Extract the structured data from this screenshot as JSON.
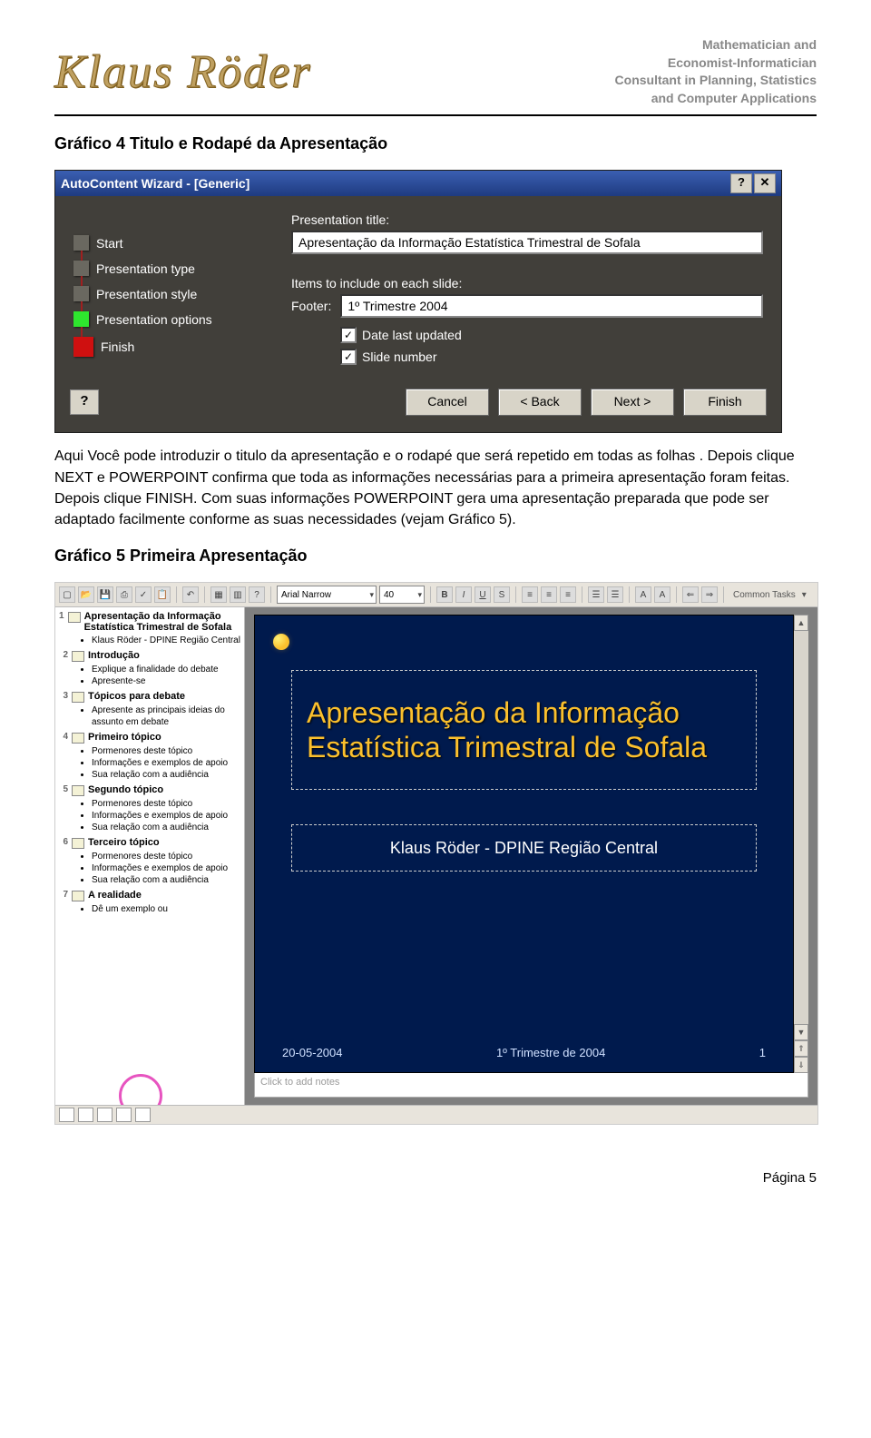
{
  "header": {
    "name": "Klaus Röder",
    "tagline": [
      "Mathematician and",
      "Economist-Informatician",
      "Consultant in Planning, Statistics",
      "and Computer Applications"
    ]
  },
  "caption1": "Gráfico 4 Titulo e Rodapé da Apresentação",
  "wizard": {
    "title": "AutoContent Wizard - [Generic]",
    "help": "?",
    "close": "✕",
    "steps": [
      {
        "label": "Start",
        "color": "#6a6860"
      },
      {
        "label": "Presentation type",
        "color": "#6a6860"
      },
      {
        "label": "Presentation style",
        "color": "#6a6860"
      },
      {
        "label": "Presentation options",
        "color": "#2ee62e"
      },
      {
        "label": "Finish",
        "color": "#cf1010"
      }
    ],
    "title_label": "Presentation title:",
    "title_value": "Apresentação da Informação Estatística Trimestral de Sofala",
    "items_label": "Items to include on each slide:",
    "footer_label": "Footer:",
    "footer_value": "1º Trimestre 2004",
    "cb_date": "Date last updated",
    "cb_slide": "Slide number",
    "help_btn": "?",
    "cancel": "Cancel",
    "back": "< Back",
    "next": "Next >",
    "finish": "Finish"
  },
  "para1": "Aqui Você pode introduzir o titulo da apresentação e o rodapé que será repetido em todas as folhas . Depois clique NEXT e  POWERPOINT  confirma que toda as informações necessárias para a primeira apresentação foram feitas. Depois clique FINISH. Com suas informações  POWERPOINT  gera uma apresentação preparada que pode ser adaptado facilmente conforme as suas necessidades (vejam Gráfico 5).",
  "caption2": "Gráfico 5 Primeira Apresentação",
  "ppt": {
    "font": "Arial Narrow",
    "size": "40",
    "common": "Common Tasks",
    "outline": [
      {
        "n": "1",
        "t": "Apresentação da Informação Estatística Trimestral de Sofala",
        "b": [
          "Klaus Röder - DPINE Região Central"
        ]
      },
      {
        "n": "2",
        "t": "Introdução",
        "b": [
          "Explique a finalidade do debate",
          "Apresente-se"
        ]
      },
      {
        "n": "3",
        "t": "Tópicos para debate",
        "b": [
          "Apresente as principais ideias do assunto em debate"
        ]
      },
      {
        "n": "4",
        "t": "Primeiro tópico",
        "b": [
          "Pormenores deste tópico",
          "Informações e exemplos de apoio",
          "Sua relação com a audiência"
        ]
      },
      {
        "n": "5",
        "t": "Segundo tópico",
        "b": [
          "Pormenores deste tópico",
          "Informações e exemplos de apoio",
          "Sua relação com a audiência"
        ]
      },
      {
        "n": "6",
        "t": "Terceiro tópico",
        "b": [
          "Pormenores deste tópico",
          "Informações e exemplos de apoio",
          "Sua relação com a audiência"
        ]
      },
      {
        "n": "7",
        "t": "A realidade",
        "b": [
          "Dê um exemplo ou"
        ]
      }
    ],
    "slide": {
      "title1": "Apresentação da Informação",
      "title2": "Estatística Trimestral de Sofala",
      "sub": "Klaus Röder - DPINE Região Central",
      "date": "20-05-2004",
      "footer": "1º Trimestre de 2004",
      "page": "1"
    },
    "notes": "Click to add notes"
  },
  "page_num": "Página 5"
}
